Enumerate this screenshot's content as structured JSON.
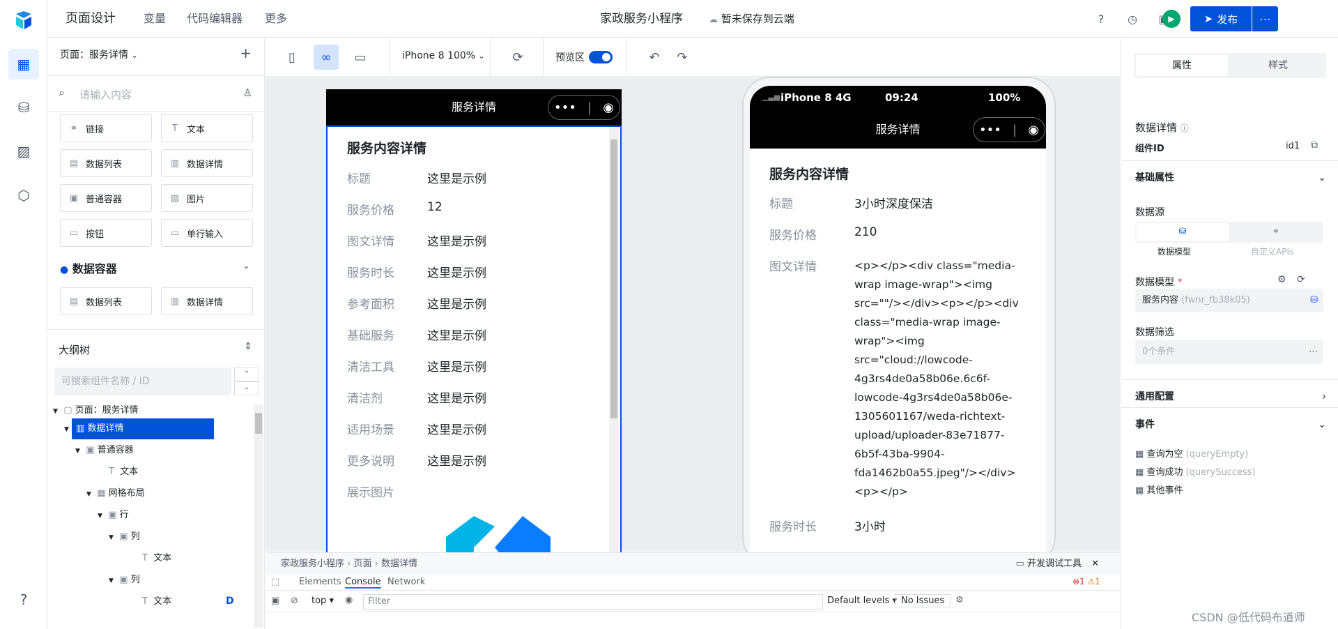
{
  "topbar": {
    "nav": [
      "页面设计",
      "变量",
      "代码编辑器",
      "更多"
    ],
    "app_title": "家政服务小程序",
    "save_status": "暂未保存到云端",
    "publish_label": "发布"
  },
  "leftpanel": {
    "page_selector": "页面：服务详情",
    "search_placeholder": "请输入内容",
    "components": [
      "链接",
      "文本",
      "数据列表",
      "数据详情",
      "普通容器",
      "图片",
      "按钮",
      "单行输入"
    ],
    "group_title": "数据容器",
    "group_components": [
      "数据列表",
      "数据详情"
    ],
    "outline_title": "大纲树",
    "outline_search_placeholder": "可搜索组件名称 / ID",
    "tree": [
      {
        "label": "页面：服务详情",
        "depth": 0
      },
      {
        "label": "数据详情",
        "depth": 1,
        "selected": true
      },
      {
        "label": "普通容器",
        "depth": 2
      },
      {
        "label": "文本",
        "depth": 3
      },
      {
        "label": "网格布局",
        "depth": 3
      },
      {
        "label": "行",
        "depth": 4
      },
      {
        "label": "列",
        "depth": 5
      },
      {
        "label": "文本",
        "depth": 6
      },
      {
        "label": "列",
        "depth": 5
      },
      {
        "label": "文本",
        "depth": 6
      }
    ],
    "tree_badge": "D"
  },
  "toolbar": {
    "device": "iPhone 8 100%",
    "preview_label": "预览区"
  },
  "editor": {
    "nav_title": "服务详情",
    "title": "服务内容详情",
    "rows": [
      {
        "label": "标题",
        "value": "这里是示例"
      },
      {
        "label": "服务价格",
        "value": "12"
      },
      {
        "label": "图文详情",
        "value": "这里是示例"
      },
      {
        "label": "服务时长",
        "value": "这里是示例"
      },
      {
        "label": "参考面积",
        "value": "这里是示例"
      },
      {
        "label": "基础服务",
        "value": "这里是示例"
      },
      {
        "label": "清洁工具",
        "value": "这里是示例"
      },
      {
        "label": "清洁剂",
        "value": "这里是示例"
      },
      {
        "label": "适用场景",
        "value": "这里是示例"
      },
      {
        "label": "更多说明",
        "value": "这里是示例"
      },
      {
        "label": "展示图片",
        "value": ""
      }
    ]
  },
  "preview": {
    "status_carrier": "iPhone 8  4G",
    "status_time": "09:24",
    "status_battery": "100%",
    "nav_title": "服务详情",
    "title": "服务内容详情",
    "row_title_label": "标题",
    "row_title_value": "3小时深度保洁",
    "row_price_label": "服务价格",
    "row_price_value": "210",
    "row_rich_label": "图文详情",
    "row_rich_lines": [
      "<p></p><div class=\"media-",
      "wrap image-wrap\"><img",
      "src=\"\"/></div><p></p><div",
      "class=\"media-wrap image-",
      "wrap\"><img",
      "src=\"cloud://lowcode-",
      "4g3rs4de0a58b06e.6c6f-",
      "lowcode-4g3rs4de0a58b06e-",
      "1305601167/weda-richtext-",
      "upload/uploader-83e71877-",
      "6b5f-43ba-9904-",
      "fda1462b0a55.jpeg\"/></div>",
      "<p></p>"
    ],
    "row_duration_label": "服务时长",
    "row_duration_value": "3小时"
  },
  "devtools": {
    "crumbs": [
      "家政服务小程序",
      "页面",
      "数据详情"
    ],
    "open_label": "开发调试工具",
    "tabs": [
      "Elements",
      "Console",
      "Network"
    ],
    "context": "top",
    "filter_placeholder": "Filter",
    "levels": "Default levels",
    "issues": "No Issues",
    "errors": "1",
    "warnings": "1"
  },
  "rightpanel": {
    "tabs": [
      "属性",
      "样式"
    ],
    "component_title": "数据详情",
    "id_label": "组件ID",
    "id_value": "id1",
    "basic_section": "基础属性",
    "datasource_label": "数据源",
    "ds_options": [
      "数据模型",
      "自定义APIs"
    ],
    "model_label": "数据模型",
    "model_value": "服务内容",
    "model_code": "(fwnr_fb38k05)",
    "filter_label": "数据筛选",
    "filter_value": "0个条件",
    "general_section": "通用配置",
    "events_section": "事件",
    "events": [
      {
        "label": "查询为空",
        "code": "(queryEmpty)"
      },
      {
        "label": "查询成功",
        "code": "(querySuccess)"
      },
      {
        "label": "其他事件",
        "code": ""
      }
    ]
  },
  "watermark": "CSDN @低代码布道师",
  "colors": {
    "primary": "#0052d9",
    "run": "#00a870"
  }
}
